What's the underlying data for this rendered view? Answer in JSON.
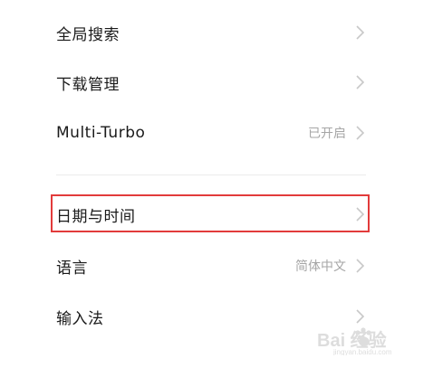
{
  "settings": {
    "items": [
      {
        "label": "全局搜索",
        "value": ""
      },
      {
        "label": "下载管理",
        "value": ""
      },
      {
        "label": "Multi-Turbo",
        "value": "已开启"
      },
      {
        "label": "日期与时间",
        "value": ""
      },
      {
        "label": "语言",
        "value": "简体中文"
      },
      {
        "label": "输入法",
        "value": ""
      }
    ],
    "highlighted_item": "日期与时间"
  },
  "watermark": {
    "text": "Bai 经验",
    "sub": "jingyan.baidu.com"
  },
  "colors": {
    "highlight_border": "#e23b3b",
    "label": "#1a1a1a",
    "value": "#a6a6a6",
    "chevron": "#c8c8c8"
  }
}
